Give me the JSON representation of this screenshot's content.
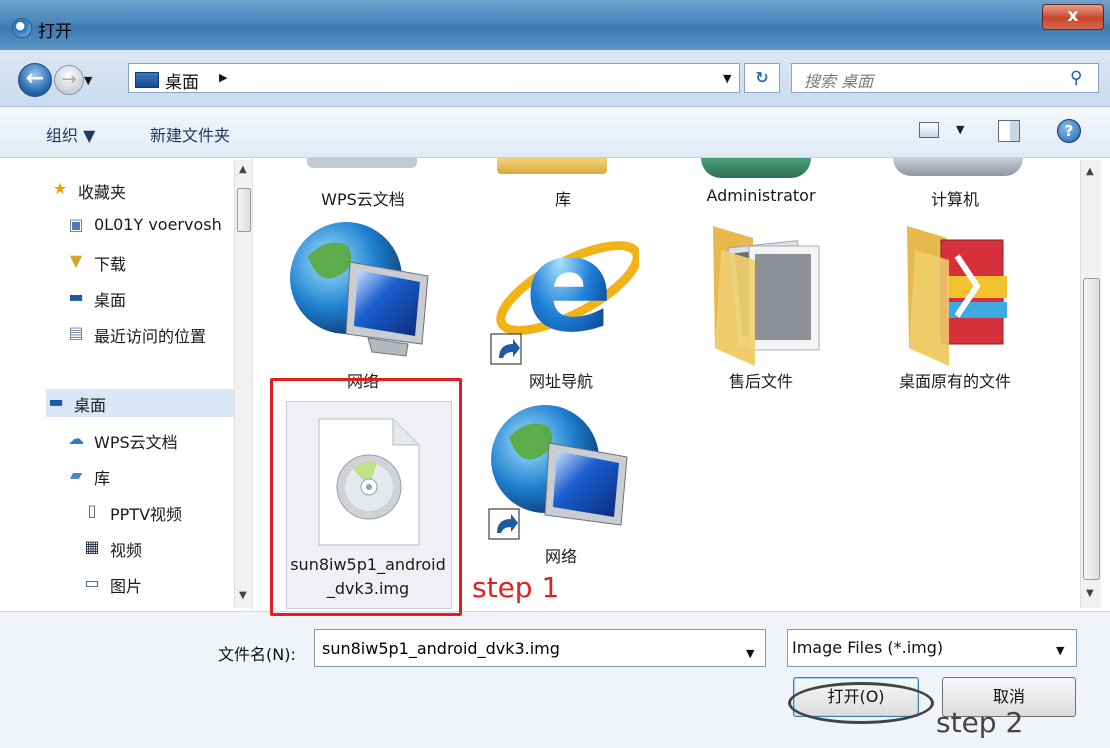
{
  "window": {
    "title": "打开",
    "close_label": "x"
  },
  "nav": {
    "back_glyph": "←",
    "forward_glyph": "→",
    "address_label": "桌面",
    "search_placeholder": "搜索 桌面"
  },
  "toolbar": {
    "organize_label": "组织 ▼",
    "new_folder_label": "新建文件夹",
    "help_glyph": "?"
  },
  "sidebar": {
    "items": [
      {
        "label": "收藏夹",
        "icon": "star-icon"
      },
      {
        "label": "0L01Y voervosh",
        "icon": "network-drive-icon"
      },
      {
        "label": "下载",
        "icon": "download-folder-icon"
      },
      {
        "label": "桌面",
        "icon": "desktop-icon"
      },
      {
        "label": "最近访问的位置",
        "icon": "recent-places-icon"
      },
      {
        "label": "桌面",
        "icon": "desktop-icon"
      },
      {
        "label": "WPS云文档",
        "icon": "cloud-icon"
      },
      {
        "label": "库",
        "icon": "library-icon"
      },
      {
        "label": "PPTV视频",
        "icon": "document-icon"
      },
      {
        "label": "视频",
        "icon": "video-icon"
      },
      {
        "label": "图片",
        "icon": "picture-icon"
      }
    ]
  },
  "content": {
    "top_row_labels": [
      "WPS云文档",
      "库",
      "Administrator",
      "计算机"
    ],
    "tiles": [
      {
        "label": "网络",
        "icon": "network-globe-icon"
      },
      {
        "label": "网址导航",
        "icon": "ie-shortcut-icon"
      },
      {
        "label": "售后文件",
        "icon": "folder-photos-icon"
      },
      {
        "label": "桌面原有的文件",
        "icon": "folder-zip-icon"
      },
      {
        "label": "sun8iw5p1_android_dvk3.img",
        "icon": "disc-image-file-icon"
      },
      {
        "label": "网络",
        "icon": "network-globe-shortcut-icon"
      }
    ]
  },
  "bottom": {
    "filename_label": "文件名(N):",
    "filename_value": "sun8iw5p1_android_dvk3.img",
    "filetype_value": "Image Files (*.img)",
    "open_label": "打开(O)",
    "cancel_label": "取消"
  },
  "annotations": {
    "step1": "step 1",
    "step2": "step 2",
    "color_step1": "#e02020",
    "color_step2": "#444444"
  }
}
